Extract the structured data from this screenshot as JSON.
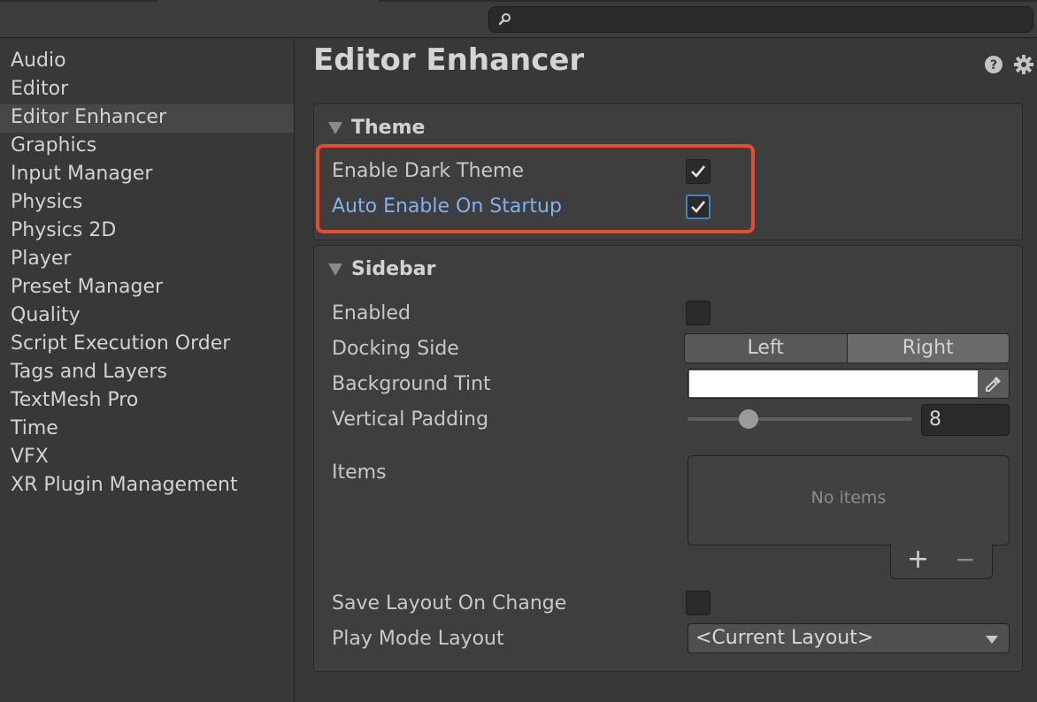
{
  "search": {
    "value": ""
  },
  "sidebar": {
    "items": [
      {
        "label": "Audio"
      },
      {
        "label": "Editor"
      },
      {
        "label": "Editor Enhancer"
      },
      {
        "label": "Graphics"
      },
      {
        "label": "Input Manager"
      },
      {
        "label": "Physics"
      },
      {
        "label": "Physics 2D"
      },
      {
        "label": "Player"
      },
      {
        "label": "Preset Manager"
      },
      {
        "label": "Quality"
      },
      {
        "label": "Script Execution Order"
      },
      {
        "label": "Tags and Layers"
      },
      {
        "label": "TextMesh Pro"
      },
      {
        "label": "Time"
      },
      {
        "label": "VFX"
      },
      {
        "label": "XR Plugin Management"
      }
    ],
    "selected": "Editor Enhancer"
  },
  "page": {
    "title": "Editor Enhancer",
    "icons": [
      "help-icon",
      "gear-icon"
    ]
  },
  "theme": {
    "title": "Theme",
    "enable_dark_theme": {
      "label": "Enable Dark Theme",
      "checked": true
    },
    "auto_enable_on_startup": {
      "label": "Auto Enable On Startup",
      "checked": true
    }
  },
  "sidebar_settings": {
    "title": "Sidebar",
    "enabled": {
      "label": "Enabled",
      "checked": false
    },
    "docking_side": {
      "label": "Docking Side",
      "options": [
        "Left",
        "Right"
      ],
      "selected": "Right"
    },
    "background_tint": {
      "label": "Background Tint",
      "color": "#ffffff"
    },
    "vertical_padding": {
      "label": "Vertical Padding",
      "value": "8"
    },
    "items": {
      "label": "Items",
      "empty_text": "No items",
      "add": "+",
      "remove": "−"
    },
    "save_layout_on_change": {
      "label": "Save Layout On Change",
      "checked": false
    },
    "play_mode_layout": {
      "label": "Play Mode Layout",
      "value": "<Current Layout>"
    }
  },
  "colors": {
    "highlight": "#e84a2e",
    "link": "#7fb2f2",
    "background": "#383838"
  }
}
